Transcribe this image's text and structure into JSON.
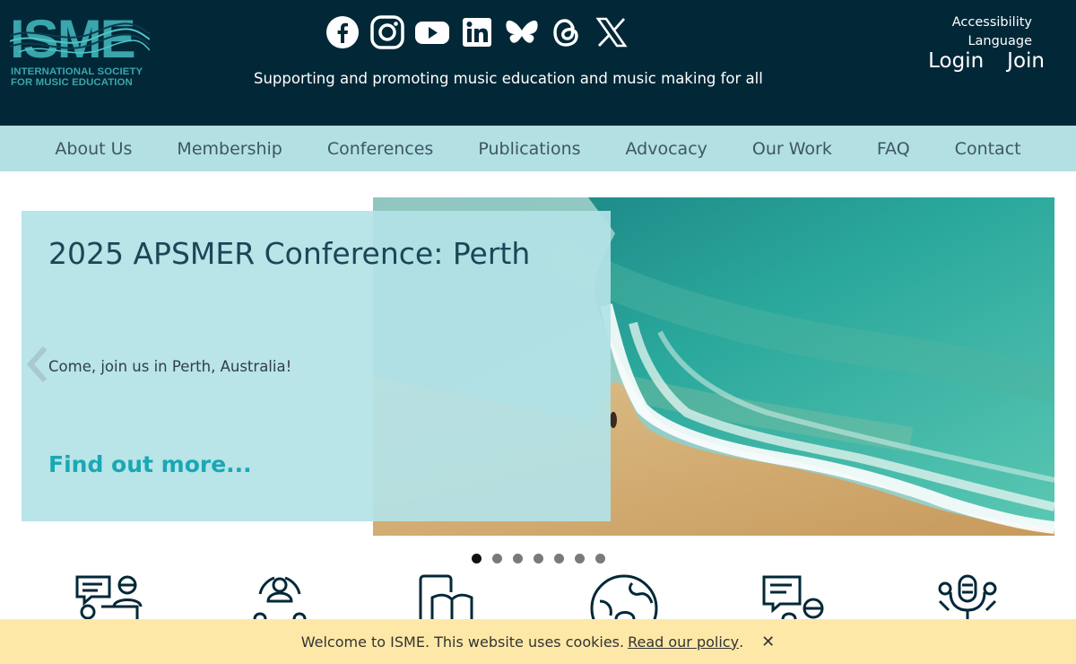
{
  "logo": {
    "wordmark": "ISME",
    "subtitle_line1": "INTERNATIONAL SOCIETY",
    "subtitle_line2": "FOR MUSIC EDUCATION"
  },
  "social_icons": [
    "facebook-icon",
    "instagram-icon",
    "youtube-icon",
    "linkedin-icon",
    "bluesky-icon",
    "threads-icon",
    "x-icon"
  ],
  "tagline": "Supporting and promoting music education and music making for all",
  "utility": {
    "accessibility": "Accessibility",
    "language": "Language",
    "login": "Login",
    "join": "Join"
  },
  "nav": {
    "items": [
      "About Us",
      "Membership",
      "Conferences",
      "Publications",
      "Advocacy",
      "Our Work",
      "FAQ",
      "Contact"
    ]
  },
  "hero": {
    "title": "2025 APSMER Conference: Perth",
    "text": "Come, join us in Perth, Australia!",
    "link": "Find out more..."
  },
  "carousel": {
    "slide_count": 7,
    "active_index": 0
  },
  "features": {
    "icons": [
      "discussion-icon",
      "community-icon",
      "publication-icon",
      "global-icon",
      "chat-icon",
      "advocacy-icon"
    ]
  },
  "cookie": {
    "text": "Welcome to ISME. This website uses cookies.",
    "link": "Read our policy",
    "suffix": ".",
    "close": "✕"
  },
  "colors": {
    "header_bg": "#022838",
    "nav_bg": "#b3e0e3",
    "accent": "#1aa8b3",
    "cookie_bg": "#fde8a8"
  }
}
